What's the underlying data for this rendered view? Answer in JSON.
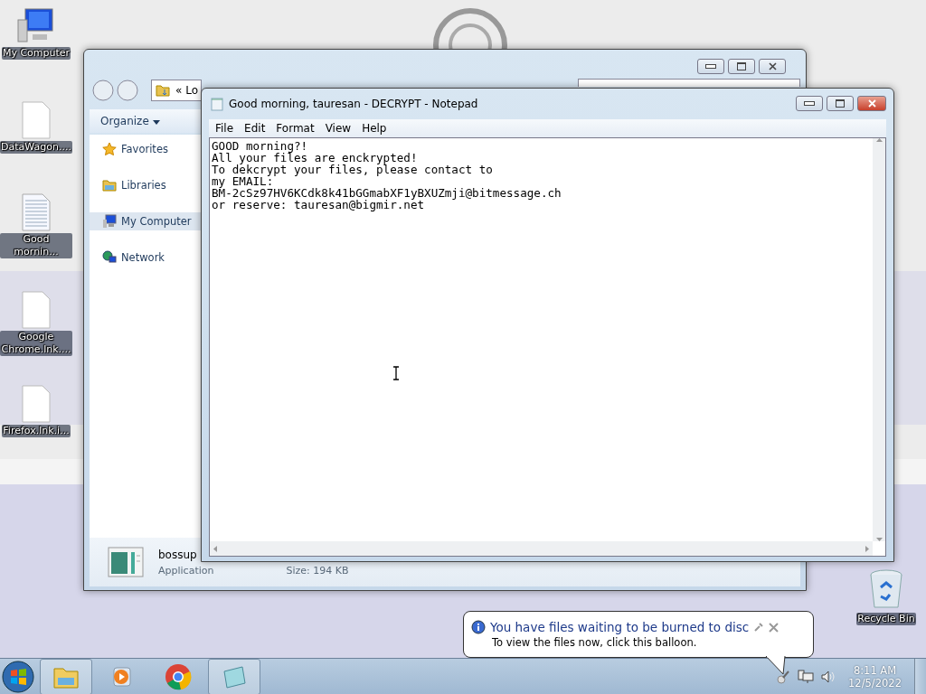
{
  "desktop_icons": [
    {
      "label": "My Computer",
      "kind": "computer"
    },
    {
      "label": "DataWagon....",
      "kind": "file"
    },
    {
      "label": "Good mornin...",
      "kind": "note"
    },
    {
      "label": "Google Chrome.lnk....",
      "kind": "file"
    },
    {
      "label": "Firefox.lnk.i...",
      "kind": "file"
    },
    {
      "label": "Recycle Bin",
      "kind": "recycle"
    }
  ],
  "explorer": {
    "address": "« Lo",
    "organize": "Organize",
    "nav_items": [
      {
        "label": "Favorites",
        "kind": "star",
        "selected": false
      },
      {
        "label": "Libraries",
        "kind": "folder",
        "selected": false
      },
      {
        "label": "My Computer",
        "kind": "computer",
        "selected": true
      },
      {
        "label": "Network",
        "kind": "network",
        "selected": false
      }
    ],
    "details": {
      "name": "bossup",
      "type": "Application",
      "size": "Size: 194 KB"
    }
  },
  "notepad": {
    "title": "Good morning, tauresan - DECRYPT - Notepad",
    "menu": [
      "File",
      "Edit",
      "Format",
      "View",
      "Help"
    ],
    "lines": [
      "GOOD morning?!",
      "All your files are enckrypted!",
      "To dekcrypt your files, please contact to",
      "my EMAIL:",
      "BM-2cSz97HV6KCdk8k41bGGmabXF1yBXUZmji@bitmessage.ch",
      "or reserve: tauresan@bigmir.net"
    ]
  },
  "balloon": {
    "title": "You have files waiting to be burned to disc",
    "message": "To view the files now, click this balloon."
  },
  "taskbar": {
    "items": [
      {
        "kind": "explorer",
        "open": true
      },
      {
        "kind": "media",
        "open": false
      },
      {
        "kind": "chrome",
        "open": false
      },
      {
        "kind": "notepad",
        "open": true
      }
    ],
    "time": "8:11 AM",
    "date": "12/5/2022"
  }
}
